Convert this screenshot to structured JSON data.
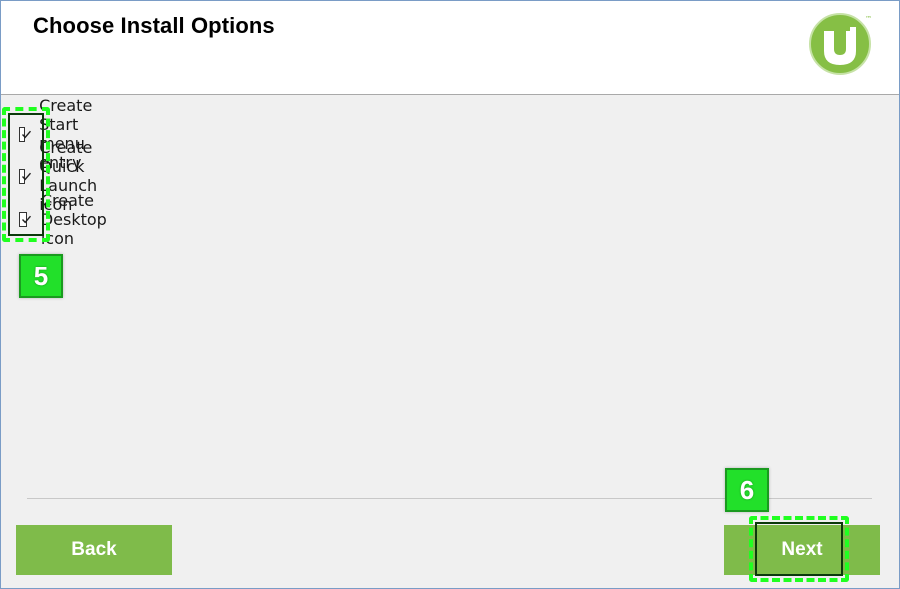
{
  "header": {
    "title": "Choose Install Options",
    "logo_icon": "utorrent-logo-icon",
    "accent_color": "#7fbb4a"
  },
  "options": [
    {
      "label": "Create Start menu entry",
      "checked": true
    },
    {
      "label": "Create Quick Launch icon",
      "checked": true
    },
    {
      "label": "Create Desktop icon",
      "checked": true
    }
  ],
  "footer": {
    "back_label": "Back",
    "next_label": "Next"
  },
  "annotations": {
    "step_5": "5",
    "step_6": "6",
    "highlight_color": "#20ff20"
  }
}
